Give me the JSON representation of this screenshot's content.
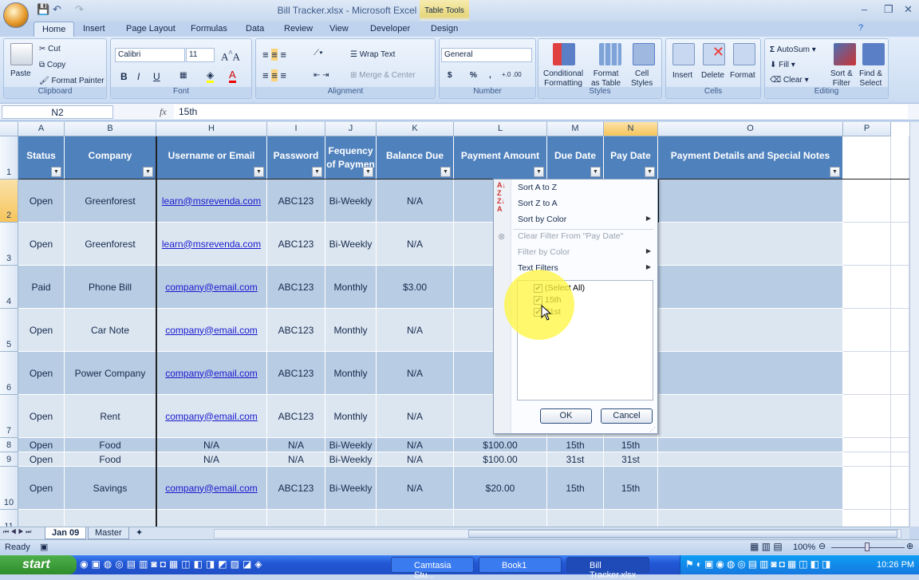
{
  "window": {
    "title": "Bill Tracker.xlsx - Microsoft Excel",
    "context_tab": "Table Tools"
  },
  "ribbon_tabs": [
    "Home",
    "Insert",
    "Page Layout",
    "Formulas",
    "Data",
    "Review",
    "View",
    "Developer",
    "Design"
  ],
  "ribbon": {
    "clipboard": {
      "label": "Clipboard",
      "paste": "Paste",
      "cut": "Cut",
      "copy": "Copy",
      "format_painter": "Format Painter"
    },
    "font": {
      "label": "Font",
      "name": "Calibri",
      "size": "11",
      "bold": "B",
      "italic": "I",
      "underline": "U"
    },
    "alignment": {
      "label": "Alignment",
      "wrap": "Wrap Text",
      "merge": "Merge & Center"
    },
    "number": {
      "label": "Number",
      "format": "General",
      "currency": "$",
      "percent": "%",
      "comma": ","
    },
    "styles": {
      "label": "Styles",
      "conditional": [
        "Conditional",
        "Formatting"
      ],
      "format_table": [
        "Format",
        "as Table"
      ],
      "cell_styles": [
        "Cell",
        "Styles"
      ]
    },
    "cells": {
      "label": "Cells",
      "insert": "Insert",
      "delete": "Delete",
      "format": "Format"
    },
    "editing": {
      "label": "Editing",
      "autosum": "AutoSum",
      "fill": "Fill",
      "clear": "Clear",
      "sort": [
        "Sort &",
        "Filter"
      ],
      "find": [
        "Find &",
        "Select"
      ]
    }
  },
  "formula_bar": {
    "name_box": "N2",
    "fx": "fx",
    "value": "15th"
  },
  "columns": [
    "A",
    "B",
    "H",
    "I",
    "J",
    "K",
    "L",
    "M",
    "N",
    "O",
    "P"
  ],
  "selected_column": "N",
  "headers": [
    "Status",
    "Company",
    "Username or Email",
    "Password",
    "Fequency of Paymen",
    "Balance Due",
    "Payment Amount",
    "Due Date",
    "Pay Date",
    "Payment Details and Special Notes"
  ],
  "rows": [
    {
      "num": "2",
      "cells": [
        "Open",
        "Greenforest",
        "learn@msrevenda.com",
        "ABC123",
        "Bi-Weekly",
        "N/A",
        "$2",
        "",
        ""
      ]
    },
    {
      "num": "3",
      "cells": [
        "Open",
        "Greenforest",
        "learn@msrevenda.com",
        "ABC123",
        "Bi-Weekly",
        "N/A",
        "$2",
        "",
        ""
      ]
    },
    {
      "num": "4",
      "cells": [
        "Paid",
        "Phone Bill",
        "company@email.com",
        "ABC123",
        "Monthly",
        "$3.00",
        "$",
        "",
        ""
      ]
    },
    {
      "num": "5",
      "cells": [
        "Open",
        "Car Note",
        "company@email.com",
        "ABC123",
        "Monthly",
        "N/A",
        "$",
        "",
        ""
      ]
    },
    {
      "num": "6",
      "cells": [
        "Open",
        "Power Company",
        "company@email.com",
        "ABC123",
        "Monthly",
        "N/A",
        "$",
        "",
        ""
      ]
    },
    {
      "num": "7",
      "cells": [
        "Open",
        "Rent",
        "company@email.com",
        "ABC123",
        "Monthly",
        "N/A",
        "$",
        "",
        ""
      ]
    },
    {
      "num": "8",
      "cells": [
        "Open",
        "Food",
        "N/A",
        "N/A",
        "Bi-Weekly",
        "N/A",
        "$100.00",
        "15th",
        "15th"
      ]
    },
    {
      "num": "9",
      "cells": [
        "Open",
        "Food",
        "N/A",
        "N/A",
        "Bi-Weekly",
        "N/A",
        "$100.00",
        "31st",
        "31st"
      ]
    },
    {
      "num": "10",
      "cells": [
        "Open",
        "Savings",
        "company@email.com",
        "ABC123",
        "Bi-Weekly",
        "N/A",
        "$20.00",
        "15th",
        "15th"
      ]
    }
  ],
  "filter_menu": {
    "sort_az": "Sort A to Z",
    "sort_za": "Sort Z to A",
    "sort_color": "Sort by Color",
    "clear_filter": "Clear Filter From \"Pay Date\"",
    "filter_color": "Filter by Color",
    "text_filters": "Text Filters",
    "items": [
      {
        "label": "(Select All)",
        "checked": true
      },
      {
        "label": "15th",
        "checked": true
      },
      {
        "label": "31st",
        "checked": true
      }
    ],
    "ok": "OK",
    "cancel": "Cancel"
  },
  "sheets": [
    "Jan 09",
    "Master"
  ],
  "active_sheet": "Jan 09",
  "status": {
    "text": "Ready",
    "zoom": "100%"
  },
  "taskbar": {
    "start": "start",
    "tasks": [
      "Camtasia Stu...",
      "Book1",
      "Bill Tracker.xlsx"
    ],
    "active_task": "Bill Tracker.xlsx",
    "clock": "10:26 PM"
  },
  "colors": {
    "header": "#4f81bd",
    "band_dark": "#b8cce4",
    "band_light": "#dce6f1",
    "selected": "#f6c55c"
  }
}
